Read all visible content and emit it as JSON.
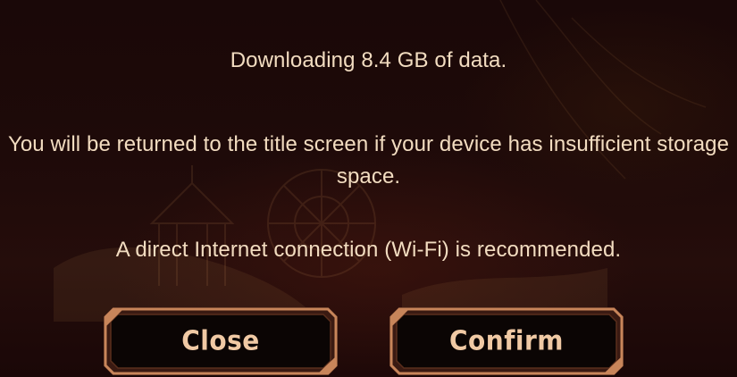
{
  "dialog": {
    "download_message": "Downloading 8.4 GB of data.",
    "storage_message": "You will be returned to the title screen if your device has insufficient storage space.",
    "connection_message": "A direct Internet connection (Wi-Fi) is recommended."
  },
  "buttons": {
    "close_label": "Close",
    "confirm_label": "Confirm"
  },
  "colors": {
    "text": "#f2dcc0",
    "button_text": "#f0c9a4",
    "button_frame": "#c8855a",
    "button_fill": "#0b0504",
    "background": "#1e0a09"
  }
}
